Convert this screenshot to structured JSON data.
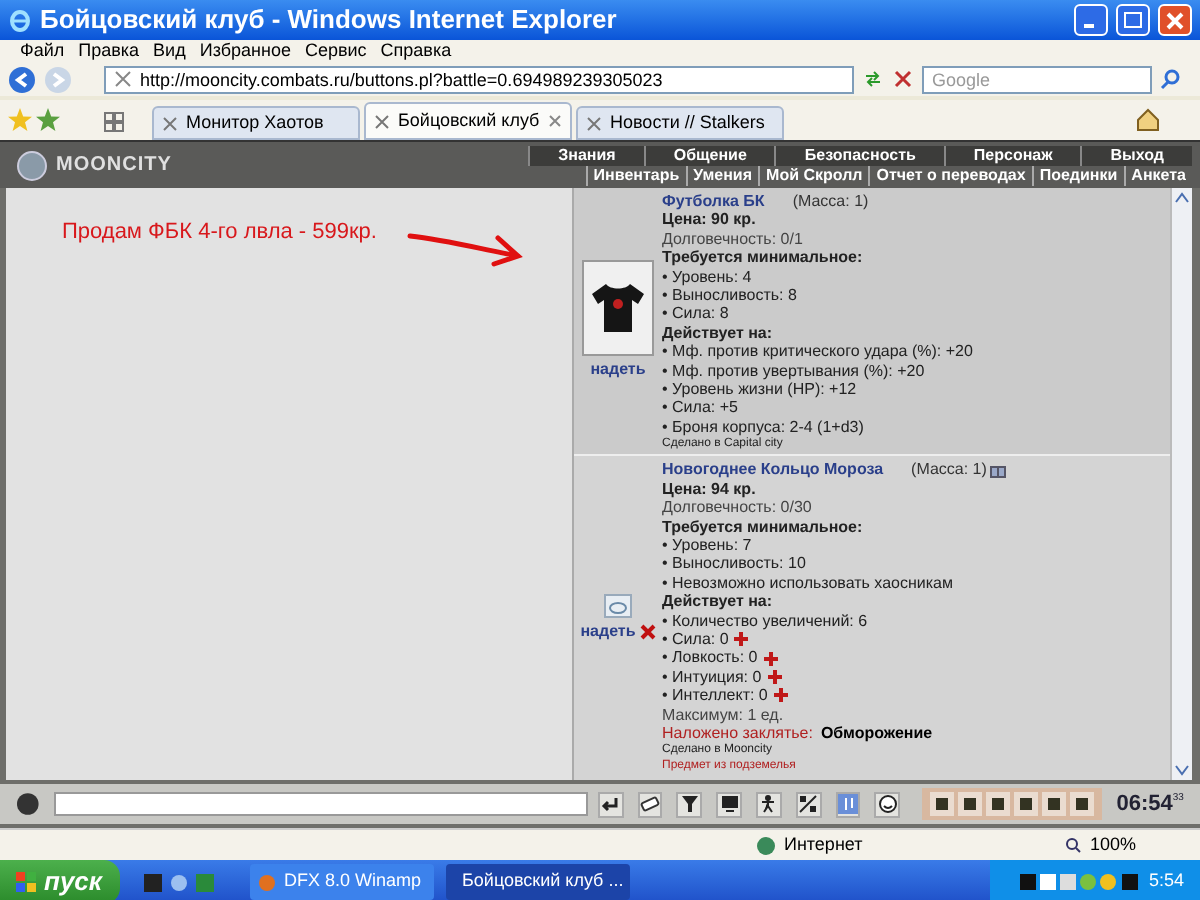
{
  "window": {
    "title": "Бойцовский клуб - Windows Internet Explorer"
  },
  "menu": [
    "Файл",
    "Правка",
    "Вид",
    "Избранное",
    "Сервис",
    "Справка"
  ],
  "address": {
    "url": "http://mooncity.combats.ru/buttons.pl?battle=0.694989239305023"
  },
  "search": {
    "placeholder": "Google"
  },
  "tabs": [
    {
      "label": "Монитор Хаотов",
      "selected": false
    },
    {
      "label": "Бойцовский клуб",
      "selected": true
    },
    {
      "label": "Новости // Stalkers",
      "selected": false
    }
  ],
  "game": {
    "logo": "MOONCITY",
    "nav_top": [
      "Знания",
      "Общение",
      "Безопасность",
      "Персонаж",
      "Выход"
    ],
    "nav_bottom": [
      "Инвентарь",
      "Умения",
      "Мой Скролл",
      "Отчет о переводах",
      "Поединки",
      "Анкета"
    ],
    "note": "Продам ФБК 4-го лвла - 599кр.",
    "items": [
      {
        "kind": "shirt",
        "name": "Футболка БК",
        "mass": "(Масса: 1)",
        "gift": false,
        "price": "Цена: 90 кр.",
        "durability": "Долговечность: 0/1",
        "requires_heading": "Требуется минимальное:",
        "requires": [
          "• Уровень: 4",
          "• Выносливость: 8",
          "• Сила: 8"
        ],
        "effects_heading": "Действует на:",
        "effects": [
          {
            "text": "• Мф. против критического удара (%): +20",
            "plus": false
          },
          {
            "text": "• Мф. против увертывания (%): +20",
            "plus": false
          },
          {
            "text": "• Уровень жизни (HP): +12",
            "plus": false
          },
          {
            "text": "• Сила: +5",
            "plus": false
          },
          {
            "text": "• Броня корпуса: 2-4 (1+d3)",
            "plus": false
          }
        ],
        "made": "Сделано в Capital city",
        "action": "надеть",
        "removable": false
      },
      {
        "kind": "ring",
        "name": "Новогоднее Кольцо Мороза",
        "mass": "(Масса: 1)",
        "gift": true,
        "price": "Цена: 94 кр.",
        "durability": "Долговечность: 0/30",
        "requires_heading": "Требуется минимальное:",
        "requires": [
          "• Уровень: 7",
          "• Выносливость: 10",
          "• Невозможно использовать хаосникам"
        ],
        "effects_heading": "Действует на:",
        "effects": [
          {
            "text": "• Количество увеличений: 6",
            "plus": false
          },
          {
            "text": "• Сила: 0",
            "plus": true
          },
          {
            "text": "• Ловкость: 0",
            "plus": true
          },
          {
            "text": "• Интуиция: 0",
            "plus": true
          },
          {
            "text": "• Интеллект: 0",
            "plus": true
          }
        ],
        "maximum": "Максимум: 1 ед.",
        "spell_label": "Наложено заклятье:",
        "spell_value": "Обморожение",
        "made": "Сделано в Mooncity",
        "origin": "Предмет из подземелья",
        "action": "надеть",
        "removable": true
      }
    ]
  },
  "clock": {
    "time": "06:54",
    "seconds": "33"
  },
  "status": {
    "zone": "Интернет",
    "zoom": "100%"
  },
  "taskbar": {
    "start": "пуск",
    "tasks": [
      {
        "label": "DFX 8.0 Winamp",
        "selected": false
      },
      {
        "label": "Бойцовский клуб ...",
        "selected": true
      }
    ],
    "time": "5:54"
  }
}
